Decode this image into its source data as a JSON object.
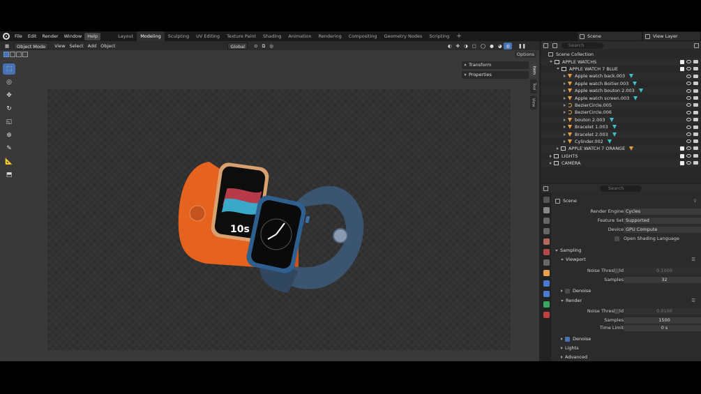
{
  "menubar": {
    "menus": [
      "File",
      "Edit",
      "Render",
      "Window",
      "Help"
    ],
    "highlighted": "Help",
    "workspaces": [
      "Layout",
      "Modeling",
      "Sculpting",
      "UV Editing",
      "Texture Paint",
      "Shading",
      "Animation",
      "Rendering",
      "Compositing",
      "Geometry Nodes",
      "Scripting"
    ],
    "active_workspace": "Modeling",
    "add_tab": "+",
    "scene": "Scene",
    "view_layer": "View Layer"
  },
  "viewport": {
    "mode": "Object Mode",
    "menus": [
      "View",
      "Select",
      "Add",
      "Object"
    ],
    "orientation": "Global",
    "options": "Options",
    "npanel_items": [
      "Transform",
      "Properties"
    ],
    "side_tabs": [
      "Item",
      "Tool",
      "View"
    ],
    "watch_text": {
      "digital": "10s",
      "face_label": "Shoe"
    },
    "colors": {
      "band_orange": "#e6621f",
      "band_blue": "#3b5570",
      "case_blue": "#2f5f8f"
    }
  },
  "outliner": {
    "search_placeholder": "Search",
    "root": "Scene Collection",
    "rows": [
      {
        "label": "APPLE WATCHS",
        "depth": 0,
        "type": "collection",
        "open": true
      },
      {
        "label": "APPLE WATCH 7 BLUE",
        "depth": 1,
        "type": "collection",
        "open": true
      },
      {
        "label": "Apple watch back.003",
        "depth": 2,
        "type": "object"
      },
      {
        "label": "Apple watch Boitier.003",
        "depth": 2,
        "type": "object"
      },
      {
        "label": "Apple watch bouton 2.003",
        "depth": 2,
        "type": "object"
      },
      {
        "label": "Apple watch screen.003",
        "depth": 2,
        "type": "object"
      },
      {
        "label": "BezierCircle.005",
        "depth": 2,
        "type": "curve"
      },
      {
        "label": "BezierCircle.006",
        "depth": 2,
        "type": "curve"
      },
      {
        "label": "bouton 2.003",
        "depth": 2,
        "type": "object"
      },
      {
        "label": "Bracelet 1.003",
        "depth": 2,
        "type": "object"
      },
      {
        "label": "Bracelet 2.003",
        "depth": 2,
        "type": "object"
      },
      {
        "label": "Cylinder.002",
        "depth": 2,
        "type": "object"
      },
      {
        "label": "APPLE WATCH 7 ORANGE",
        "depth": 1,
        "type": "collection",
        "open": false
      },
      {
        "label": "LIGHTS",
        "depth": 0,
        "type": "collection",
        "open": false
      },
      {
        "label": "CAMERA",
        "depth": 0,
        "type": "collection",
        "open": false
      }
    ]
  },
  "properties": {
    "search_placeholder": "Search",
    "context": "Scene",
    "render_engine_label": "Render Engine",
    "render_engine": "Cycles",
    "feature_set_label": "Feature Set",
    "feature_set": "Supported",
    "device_label": "Device",
    "device": "GPU Compute",
    "osl_label": "Open Shading Language",
    "sampling": "Sampling",
    "viewport_section": "Viewport",
    "noise_threshold_label": "Noise Threshold",
    "viewport_noise_threshold": "0.1000",
    "samples_label": "Samples",
    "viewport_samples": "32",
    "denoise_label": "Denoise",
    "render_section": "Render",
    "render_noise_threshold": "0.0100",
    "render_samples": "1500",
    "time_limit_label": "Time Limit",
    "time_limit": "0 s",
    "lights_section": "Lights",
    "advanced_section": "Advanced"
  }
}
